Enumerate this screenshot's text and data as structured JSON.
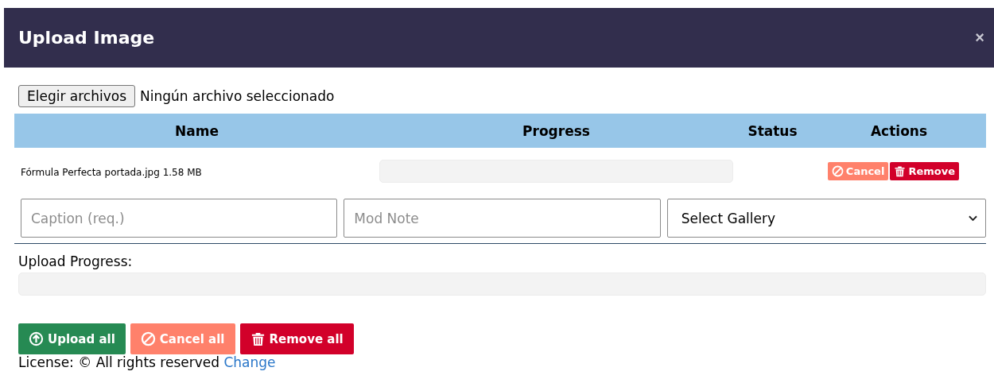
{
  "dialog": {
    "title": "Upload Image",
    "close": "×"
  },
  "file_picker": {
    "button": "Elegir archivos",
    "status": "Ningún archivo seleccionado"
  },
  "table": {
    "columns": [
      "Name",
      "Progress",
      "Status",
      "Actions"
    ],
    "rows": [
      {
        "name": "Fórmula Perfecta portada.jpg 1.58 MB",
        "level": 0,
        "actions": [
          {
            "kind": "cancel",
            "label": "Cancel"
          },
          {
            "kind": "remove",
            "label": "Remove"
          }
        ]
      }
    ]
  },
  "fields": [
    {
      "kind": "input",
      "placeholder": "Caption (req.)"
    },
    {
      "kind": "input",
      "placeholder": "Mod Note"
    },
    {
      "kind": "select",
      "value": "Select Gallery"
    }
  ],
  "upload_progress": {
    "label": "Upload Progress:",
    "level": 0
  },
  "buttons": [
    {
      "kind": "upload",
      "label": "Upload all"
    },
    {
      "kind": "cancel",
      "label": "Cancel all"
    },
    {
      "kind": "remove",
      "label": "Remove all"
    }
  ],
  "license": {
    "text": "License: © All rights reserved",
    "link": "Change"
  }
}
